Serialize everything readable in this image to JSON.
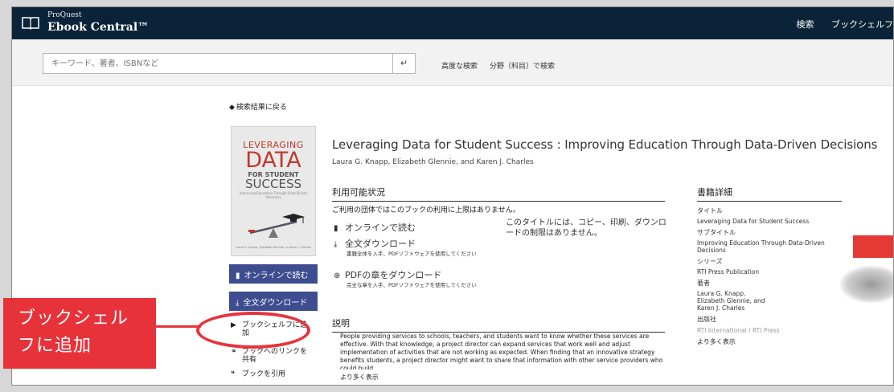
{
  "header": {
    "brand_small": "ProQuest",
    "brand_big": "Ebook Central™",
    "nav": [
      "検索",
      "ブックシェルフ"
    ]
  },
  "search": {
    "placeholder": "キーワード、著者、ISBNなど",
    "go_icon": "↵",
    "advanced": "高度な検索",
    "by_field": "分野（科目）で検索"
  },
  "back_label": "検索結果に戻る",
  "cover": {
    "line1": "LEVERAGING",
    "line2": "DATA",
    "line3": "FOR STUDENT",
    "line4": "SUCCESS",
    "subtitle": "Improving Education Through Data-Driven Decisions",
    "authors": "Laura G. Knapp, Elizabeth Glennie, & Karen J. Charles"
  },
  "buttons": {
    "read_online": "オンラインで読む",
    "full_download": "全文ダウンロード"
  },
  "side_links": {
    "add_to_shelf": "ブックシェルフに追加",
    "share_link": "ブックへのリンクを共有",
    "cite": "ブックを引用"
  },
  "book": {
    "title": "Leveraging Data for Student Success : Improving Education Through Data-Driven Decisions",
    "authors": "Laura G. Knapp, Elizabeth Glennie, and Karen J. Charles"
  },
  "availability": {
    "heading": "利用可能状況",
    "note": "ご利用の団体ではこのブックの利用に上限はありません。",
    "read_online": "オンラインで読む",
    "full_download": "全文ダウンロード",
    "full_download_sub": "書籍全体を入手、PDFソフトウェアを使用してください",
    "pdf_chapter": "PDFの章をダウンロード",
    "pdf_chapter_sub": "完全な章を入手、PDFソフトウェアを使用してください",
    "rights": "このタイトルには、コピー、印刷、ダウンロードの制限はありません。"
  },
  "description": {
    "heading": "説明",
    "text": "People providing services to schools, teachers, and students want to know whether these services are effective. With that knowledge, a project director can expand services that work well and adjust implementation of activities that are not working as expected. When finding that an innovative strategy benefits students, a project director might want to share that information with other service providers who could build",
    "more": "より多く表示"
  },
  "details": {
    "heading": "書籍詳細",
    "title_label": "タイトル",
    "title_value": "Leveraging Data for Student Success",
    "subtitle_label": "サブタイトル",
    "subtitle_value": "Improving Education Through Data-Driven Decisions",
    "series_label": "シリーズ",
    "series_value": "RTI Press Publication",
    "author_label": "著者",
    "author_value": "Laura G. Knapp, Elizabeth Glennie, and Karen J. Charles",
    "publisher_label": "出版社",
    "publisher_value": "RTI International / RTI Press",
    "more": "より多く表示"
  },
  "annotation": {
    "callout": "ブックシェルフに追加",
    "color": "#e8323a"
  },
  "colors": {
    "header_bg": "#0b2338",
    "button_bg": "#3d4d8f"
  }
}
